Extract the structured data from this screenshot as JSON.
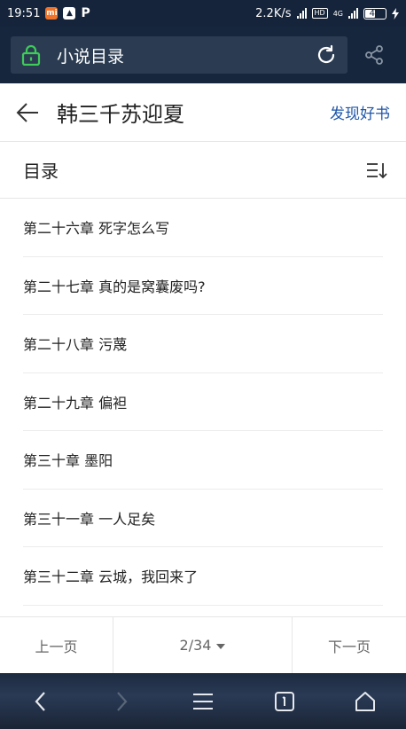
{
  "status_bar": {
    "time": "19:51",
    "network_speed": "2.2K/s",
    "network_type": "4G",
    "battery": "45"
  },
  "browser": {
    "address_title": "小说目录"
  },
  "book": {
    "title": "韩三千苏迎夏",
    "discover_label": "发现好书"
  },
  "toc": {
    "title": "目录",
    "chapters": [
      "第二十六章 死字怎么写",
      "第二十七章 真的是窝囊废吗?",
      "第二十八章 污蔑",
      "第二十九章 偏袒",
      "第三十章 墨阳",
      "第三十一章 一人足矣",
      "第三十二章 云城，我回来了"
    ]
  },
  "pager": {
    "prev_label": "上一页",
    "page_indicator": "2/34",
    "next_label": "下一页"
  },
  "colors": {
    "accent": "#1f56a8",
    "lock_green": "#3ecb5a"
  }
}
